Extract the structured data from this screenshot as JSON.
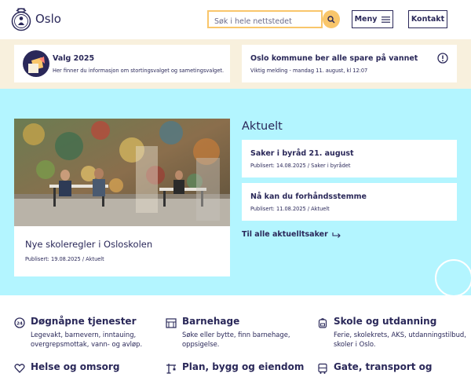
{
  "header": {
    "logo_text": "Oslo",
    "search_placeholder": "Søk i hele nettstedet",
    "menu_label": "Meny",
    "contact_label": "Kontakt"
  },
  "alerts": [
    {
      "title": "Valg 2025",
      "text": "Her finner du informasjon om stortingsvalget og sametingsvalget."
    },
    {
      "title": "Oslo kommune ber alle spare på vannet",
      "text": "Viktig melding - mandag 11. august, kl 12:07"
    }
  ],
  "feature": {
    "title": "Nye skoleregler i Osloskolen",
    "meta": "Publisert: 19.08.2025 / Aktuelt"
  },
  "aktuelt": {
    "heading": "Aktuelt",
    "items": [
      {
        "title": "Saker i byråd 21. august",
        "meta": "Publisert: 14.08.2025 / Saker i byrådet"
      },
      {
        "title": "Nå kan du forhåndsstemme",
        "meta": "Publisert: 11.08.2025 / Aktuelt"
      }
    ],
    "all_link": "Til alle aktuelltsaker"
  },
  "services": [
    {
      "title": "Døgnåpne tjenester",
      "desc": "Legevakt, barnevern, inntauing, overgrepsmottak, vann- og avløp.",
      "icon": "clock-24-icon"
    },
    {
      "title": "Barnehage",
      "desc": "Søke eller bytte, finn barnehage, oppsigelse.",
      "icon": "kindergarten-icon"
    },
    {
      "title": "Skole og utdanning",
      "desc": "Ferie, skolekrets, AKS, utdanningstilbud, skoler i Oslo.",
      "icon": "backpack-icon"
    },
    {
      "title": "Helse og omsorg",
      "desc": "",
      "icon": "heart-hand-icon"
    },
    {
      "title": "Plan, bygg og eiendom",
      "desc": "",
      "icon": "crane-icon"
    },
    {
      "title": "Gate, transport og",
      "desc": "",
      "icon": "bus-icon"
    }
  ],
  "colors": {
    "primary": "#2a2859",
    "yellow": "#f9c66b",
    "cyan": "#b3f5ff",
    "beige": "#f8f0dd"
  }
}
